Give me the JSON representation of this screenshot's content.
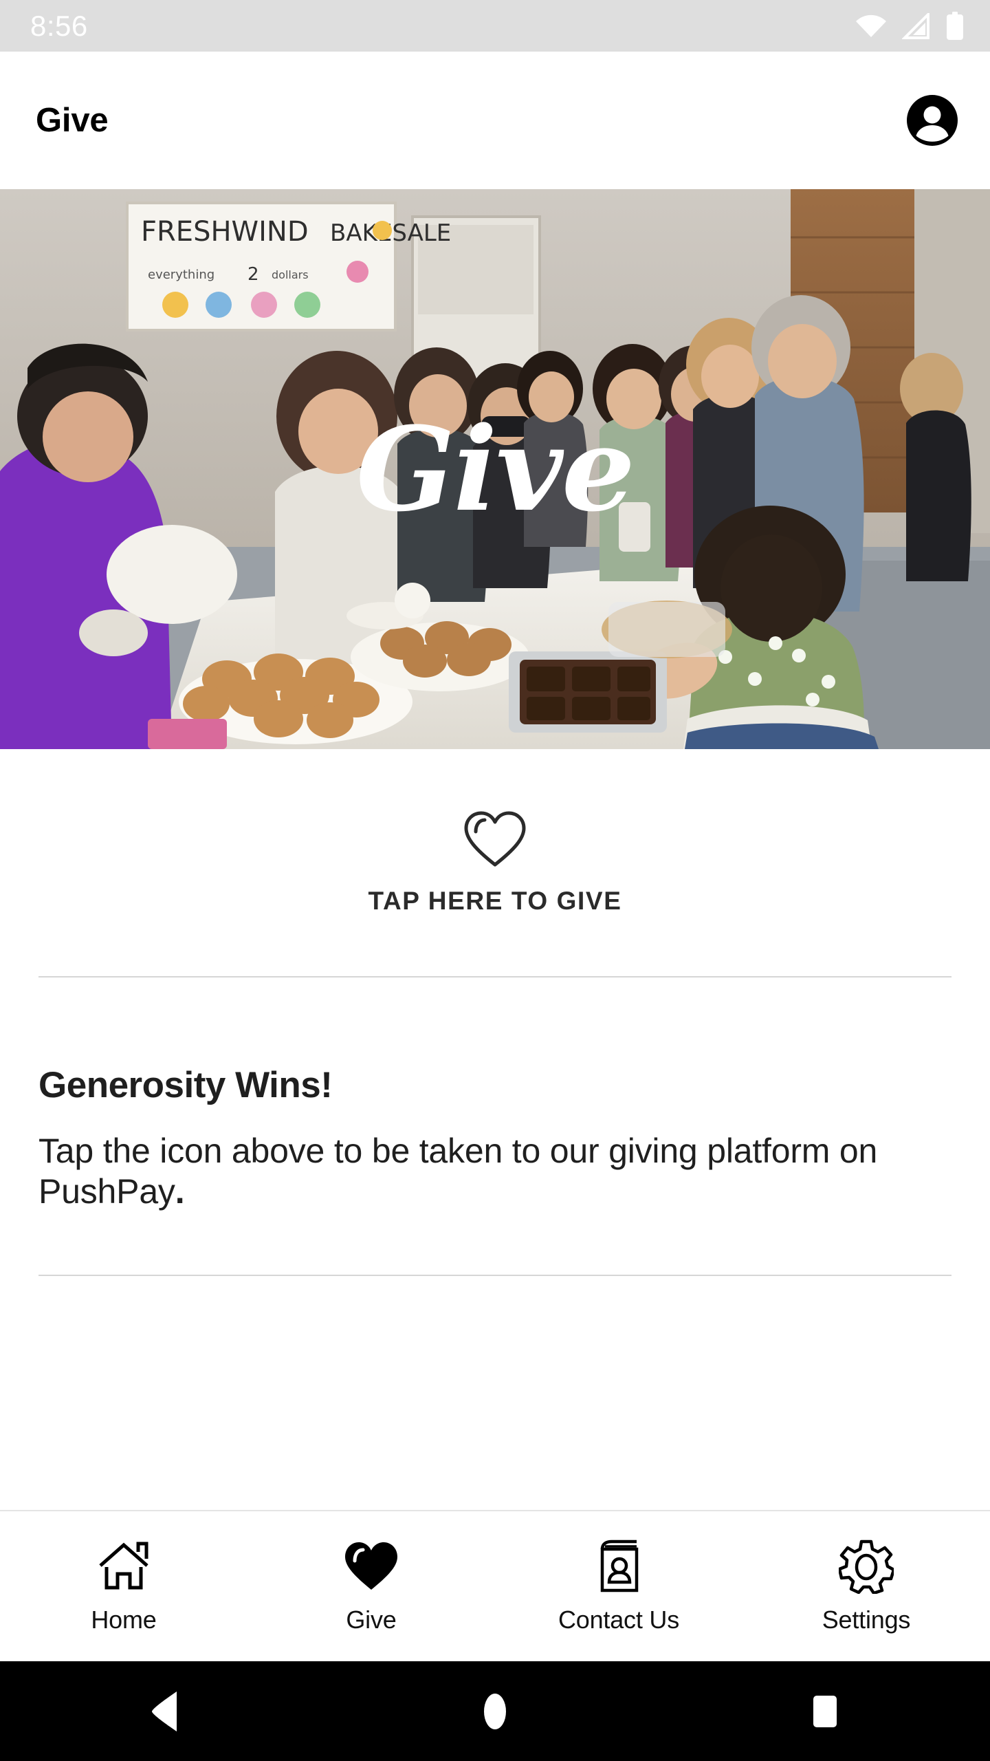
{
  "status_bar": {
    "time": "8:56",
    "icons": [
      "wifi-icon",
      "cellular-signal-icon",
      "battery-icon"
    ],
    "background": "#dedede",
    "foreground": "#ffffff"
  },
  "app_bar": {
    "title": "Give",
    "profile_icon": "account-circle-icon"
  },
  "hero": {
    "overlay_word": "Give",
    "alt": "Volunteers at the Freshwind Bakesale serving baked goods at a table",
    "sign_text": "FRESHWIND BAKESALE",
    "sign_subtext": "everything 2 dollars"
  },
  "give_cta": {
    "icon": "heart-outline-icon",
    "label": "TAP HERE TO GIVE"
  },
  "article": {
    "heading": "Generosity Wins!",
    "body_text": "Tap the icon above to be taken to our giving platform on PushPay",
    "body_period": "."
  },
  "tab_bar": {
    "active_index": 1,
    "tabs": [
      {
        "label": "Home",
        "icon": "home-icon"
      },
      {
        "label": "Give",
        "icon": "heart-filled-icon"
      },
      {
        "label": "Contact Us",
        "icon": "contact-book-icon"
      },
      {
        "label": "Settings",
        "icon": "gear-icon"
      }
    ]
  },
  "system_nav": {
    "buttons": [
      {
        "name": "back",
        "icon": "triangle-back-icon"
      },
      {
        "name": "home",
        "icon": "circle-home-icon"
      },
      {
        "name": "recents",
        "icon": "square-recents-icon"
      }
    ],
    "background": "#000000"
  },
  "colors": {
    "divider": "#d6d6d6",
    "text_primary": "#1f1f1f",
    "tab_border": "#e4e4e4"
  }
}
